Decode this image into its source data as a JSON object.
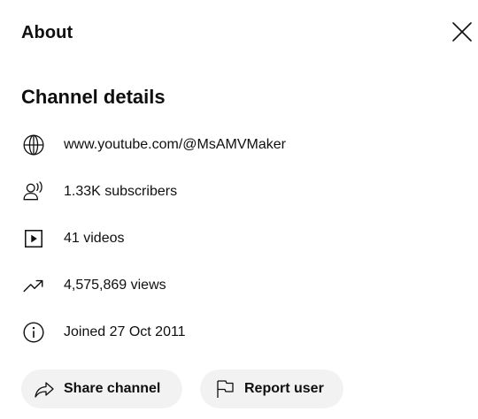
{
  "dialog": {
    "title": "About",
    "close_icon": "close-icon"
  },
  "channel_details": {
    "heading": "Channel details",
    "items": [
      {
        "icon": "globe-icon",
        "text": "www.youtube.com/@MsAMVMaker"
      },
      {
        "icon": "subscribers-icon",
        "text": "1.33K subscribers"
      },
      {
        "icon": "video-play-icon",
        "text": "41 videos"
      },
      {
        "icon": "trending-icon",
        "text": "4,575,869 views"
      },
      {
        "icon": "info-icon",
        "text": "Joined 27 Oct 2011"
      }
    ]
  },
  "actions": {
    "share_label": "Share channel",
    "share_icon": "share-icon",
    "report_label": "Report user",
    "report_icon": "flag-icon"
  },
  "colors": {
    "text": "#0f0f0f",
    "pill_bg": "#f2f2f2",
    "background": "#ffffff"
  }
}
